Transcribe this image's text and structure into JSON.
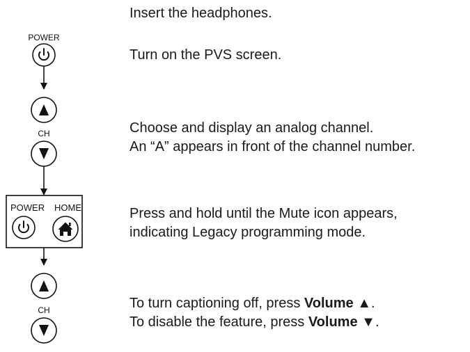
{
  "labels": {
    "power": "POWER",
    "home": "HOME",
    "ch": "CH"
  },
  "steps": {
    "step1": "Insert the headphones.",
    "step2": "Turn on the PVS screen.",
    "step3_line1": "Choose and display an analog channel.",
    "step3_line2": "An “A” appears in front of the channel number.",
    "step4_line1": "Press and hold until the Mute icon appears,",
    "step4_line2": "indicating Legacy programming mode.",
    "step5_line1_pre": "To turn captioning off, press ",
    "step5_line1_bold": "Volume ▲",
    "step5_line1_post": ".",
    "step5_line2_pre": "To disable the feature, press ",
    "step5_line2_bold": "Volume ▼",
    "step5_line2_post": "."
  },
  "icons": {
    "power": "power-icon",
    "home": "home-icon",
    "up": "triangle-up-icon",
    "down": "triangle-down-icon",
    "arrow": "arrow-down-icon"
  }
}
